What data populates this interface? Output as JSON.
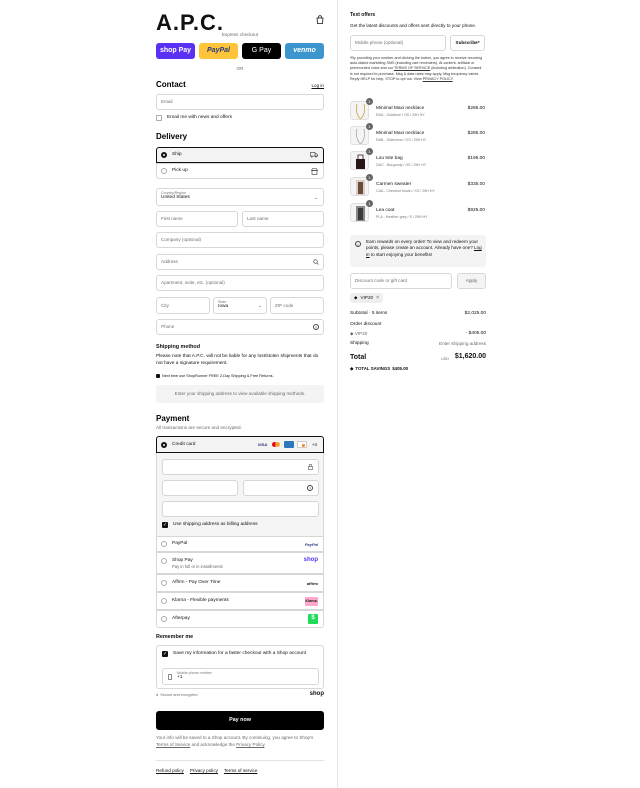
{
  "brand": "A.P.C.",
  "express": {
    "title": "Express checkout",
    "buttons": [
      {
        "label": "shop Pay",
        "color": "#5a31f4"
      },
      {
        "label": "PayPal",
        "color": "#ffc439"
      },
      {
        "label": "G Pay",
        "color": "#000000"
      },
      {
        "label": "venmo",
        "color": "#3d95ce"
      }
    ],
    "or": "OR"
  },
  "contact": {
    "title": "Contact",
    "login": "Log in",
    "email_placeholder": "Email",
    "news_label": "Email me with news and offers"
  },
  "delivery": {
    "title": "Delivery",
    "options": [
      {
        "label": "Ship",
        "selected": true
      },
      {
        "label": "Pick up",
        "selected": false
      }
    ],
    "country_label": "Country/Region",
    "country_value": "United States",
    "first_name": "First name",
    "last_name": "Last name",
    "company": "Company (optional)",
    "address": "Address",
    "apartment": "Apartment, suite, etc. (optional)",
    "city": "City",
    "state_label": "State",
    "state_value": "Iowa",
    "zip": "ZIP code",
    "phone": "Phone"
  },
  "shipping": {
    "title": "Shipping method",
    "note": "Please note that A.P.C. will not be liable for any lost/stolen shipments that do not have a signature requirement.",
    "promo": "Next time use ShopRunner FREE 2-Day Shipping & Free Returns.",
    "placeholder": "Enter your shipping address to view available shipping methods."
  },
  "payment": {
    "title": "Payment",
    "secure": "All transactions are secure and encrypted.",
    "card_label": "Credit card",
    "card_more": "+4",
    "billing_label": "Use shipping address as billing address",
    "methods": [
      {
        "label": "PayPal",
        "sub": "",
        "logo": "PayPal"
      },
      {
        "label": "Shop Pay",
        "sub": "Pay in full or in installments",
        "logo": "shop"
      },
      {
        "label": "Affirm - Pay Over Time",
        "sub": "",
        "logo": "affirm"
      },
      {
        "label": "Klarna - Flexible payments",
        "sub": "",
        "logo": "Klarna."
      },
      {
        "label": "Afterpay",
        "sub": "",
        "logo": "$"
      }
    ]
  },
  "remember": {
    "title": "Remember me",
    "save_label": "Save my information for a faster checkout with a Shop account",
    "phone_label": "Mobile phone number",
    "phone_value": "+1",
    "secure": "Secure and encrypted",
    "shop": "shop"
  },
  "pay_button": "Pay now",
  "legal": {
    "text_before": "Your info will be saved to a Shop account. By continuing, you agree to Shop's ",
    "tos": "Terms of Service",
    "text_mid": " and acknowledge the ",
    "privacy": "Privacy Policy",
    "text_end": "."
  },
  "footer": [
    "Refund policy",
    "Privacy policy",
    "Terms of service"
  ],
  "sidebar": {
    "text_offers_title": "Text offers",
    "text_offers_desc": "Get the latest discounts and offers sent directly to your phone.",
    "mobile_placeholder": "Mobile phone (optional)",
    "subscribe": "Subscribe*",
    "disclaimer_a": "*By providing your number and clicking the button, you agree to receive recurring auto-dialed marketing SMS (including cart reminders). At content: artificial or prerecorded voice and our ",
    "tos": "TERMS OF SERVICE",
    "disclaimer_b": " (including arbitration). Consent is not required to purchase. Msg & data rates may apply. Msg frequency varies. Reply HELP for help, STOP to opt out. View ",
    "privacy": "PRIVACY POLICY",
    "disclaimer_c": ".",
    "items": [
      {
        "qty": "1",
        "name": "Minimal Maxi necklace",
        "variant": "RAA - Goldtone / OS / 25H HY",
        "price": "$285.00",
        "kind": "necklace"
      },
      {
        "qty": "1",
        "name": "Minimal Maxi necklace",
        "variant": "RAB - Silvertone / OS / 25H HY",
        "price": "$285.00",
        "kind": "necklace"
      },
      {
        "qty": "1",
        "name": "Lou tote bag",
        "variant": "GAC - Burgundy / OS / 25H HY",
        "price": "$195.00",
        "kind": "bag"
      },
      {
        "qty": "1",
        "name": "Carmen sweater",
        "variant": "CAA - Chestnut brown / XS / 25H HY",
        "price": "$335.00",
        "kind": "sweater"
      },
      {
        "qty": "1",
        "name": "Lea coat",
        "variant": "PLA - Heather grey / S / 25H HY",
        "price": "$925.00",
        "kind": "coat"
      }
    ],
    "rewards_a": "Earn rewards on every order! To view and redeem your points, please create an account. Already have one? ",
    "rewards_login": "Log in",
    "rewards_b": " to start enjoying your benefits!",
    "discount_placeholder": "Discount code or gift card",
    "apply": "Apply",
    "code": "VIP20",
    "subtotal_label": "Subtotal · 5 items",
    "subtotal": "$2,025.00",
    "order_discount": "Order discount",
    "code_line": "VIP20",
    "discount_value": "- $405.00",
    "shipping_label": "Shipping",
    "shipping_value": "Enter shipping address",
    "total_label": "Total",
    "currency": "USD",
    "total": "$1,620.00",
    "savings_label": "TOTAL SAVINGS",
    "savings": "$405.00"
  }
}
